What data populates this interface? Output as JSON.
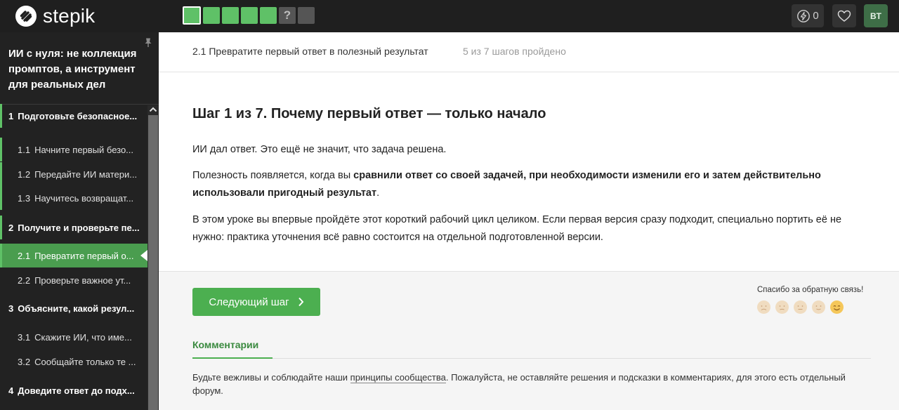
{
  "brand": {
    "name": "stepik",
    "accent": "#4caf50",
    "progress_green": "#5fc167"
  },
  "topbar": {
    "step_count": 7,
    "steps": [
      {
        "state": "done",
        "current": true
      },
      {
        "state": "done"
      },
      {
        "state": "done"
      },
      {
        "state": "done"
      },
      {
        "state": "done"
      },
      {
        "state": "quiz",
        "symbol": "?"
      },
      {
        "state": "todo"
      }
    ],
    "energy_count": "0",
    "energy_icon": "lightning-icon",
    "favorite_icon": "heart-icon",
    "avatar_initials": "BT"
  },
  "sidebar": {
    "course_title": "ИИ с нуля: не коллекция промптов, а инструмент для реальных дел",
    "pin_icon": "pin-icon",
    "items": [
      {
        "type": "section",
        "num": "1",
        "label": "Подготовьте безопасное..."
      },
      {
        "type": "lesson",
        "num": "1.1",
        "label": "Начните первый безо..."
      },
      {
        "type": "lesson",
        "num": "1.2",
        "label": "Передайте ИИ матери..."
      },
      {
        "type": "lesson",
        "num": "1.3",
        "label": "Научитесь возвращат..."
      },
      {
        "type": "section",
        "num": "2",
        "label": "Получите и проверьте пе..."
      },
      {
        "type": "lesson",
        "num": "2.1",
        "label": "Превратите первый о...",
        "active": true
      },
      {
        "type": "lesson",
        "num": "2.2",
        "label": "Проверьте важное ут..."
      },
      {
        "type": "section",
        "num": "3",
        "label": "Объясните, какой резул..."
      },
      {
        "type": "lesson",
        "num": "3.1",
        "label": "Скажите ИИ, что име..."
      },
      {
        "type": "lesson",
        "num": "3.2",
        "label": "Сообщайте только те ..."
      },
      {
        "type": "section",
        "num": "4",
        "label": "Доведите ответ до подх..."
      }
    ]
  },
  "main": {
    "breadcrumb": "2.1 Превратите первый ответ в полезный результат",
    "progress": "5 из 7 шагов пройдено",
    "step_title": "Шаг 1 из 7. Почему первый ответ — только начало",
    "p1": "ИИ дал ответ. Это ещё не значит, что задача решена.",
    "p2_start": "Полезность появляется, когда вы ",
    "p2_bold": "сравнили ответ со своей задачей, при необходимости изменили его и затем действительно использовали пригодный результат",
    "p2_end": ".",
    "p3": "В этом уроке вы впервые пройдёте этот короткий рабочий цикл целиком. Если первая версия сразу подходит, специально портить её не нужно: практика уточнения всё равно состоится на отдельной подготовленной версии.",
    "next_button": "Следующий шаг",
    "feedback_label": "Спасибо за обратную связь!",
    "comments_tab": "Комментарии",
    "comments_note_start": "Будьте вежливы и соблюдайте наши ",
    "comments_note_link": "принципы сообщества",
    "comments_note_end": ". Пожалуйста, не оставляйте решения и подсказки в комментариях, для этого есть отдельный форум."
  }
}
